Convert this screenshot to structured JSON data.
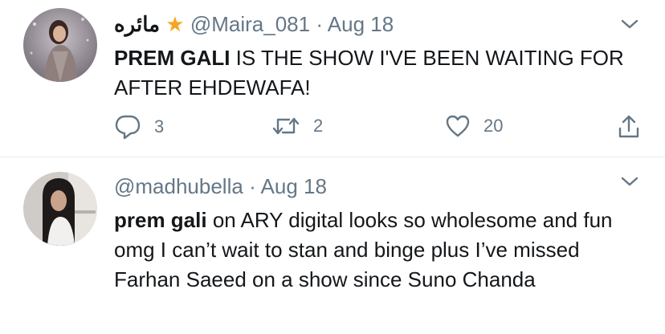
{
  "tweets": [
    {
      "display_name": "مائره",
      "display_name_emoji": "★",
      "handle": "@Maira_081",
      "separator": "·",
      "date": "Aug 18",
      "text_strong": "PREM GALI",
      "text_rest": " IS THE SHOW I'VE BEEN WAITING FOR AFTER EHDEWAFA!",
      "replies": "3",
      "retweets": "2",
      "likes": "20"
    },
    {
      "handle": "@madhubella",
      "separator": "·",
      "date": "Aug 18",
      "text_strong": "prem gali",
      "text_rest": " on ARY digital looks so wholesome and fun omg I can’t wait to stan and binge plus I’ve missed Farhan Saeed on a show since Suno Chanda"
    }
  ],
  "colors": {
    "text": "#14171a",
    "muted": "#657786",
    "divider": "#e6ecf0"
  },
  "icons": [
    "reply-icon",
    "retweet-icon",
    "like-icon",
    "share-icon",
    "chevron-down-icon"
  ]
}
